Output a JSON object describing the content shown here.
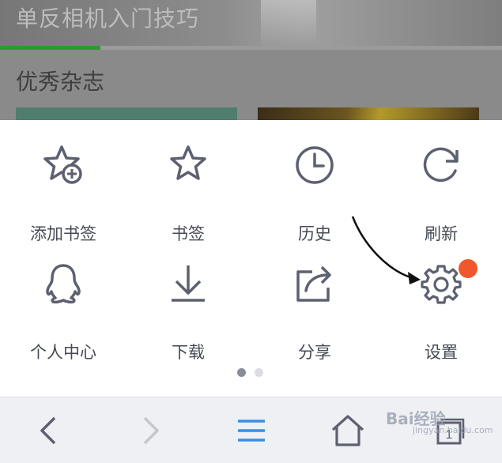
{
  "background_page": {
    "banner_title": "单反相机入门技巧",
    "section_title": "优秀杂志",
    "progress_percent": 20
  },
  "menu": {
    "items": [
      {
        "label": "添加书签",
        "icon": "add-bookmark-star-icon"
      },
      {
        "label": "书签",
        "icon": "bookmark-star-icon"
      },
      {
        "label": "历史",
        "icon": "history-clock-icon"
      },
      {
        "label": "刷新",
        "icon": "refresh-icon"
      },
      {
        "label": "个人中心",
        "icon": "qq-penguin-icon"
      },
      {
        "label": "下载",
        "icon": "download-icon"
      },
      {
        "label": "分享",
        "icon": "share-icon"
      },
      {
        "label": "设置",
        "icon": "settings-gear-icon"
      }
    ],
    "page_indicator": {
      "pages": 2,
      "current": 1
    },
    "settings_badge_color": "#f0572c"
  },
  "toolbar": {
    "buttons": [
      "back-icon",
      "forward-icon",
      "menu-icon",
      "home-icon",
      "tabs-icon"
    ],
    "tabs_count": "1"
  },
  "watermark": {
    "text": "Bai经验",
    "sub": "jingyan.baidu.com"
  },
  "colors": {
    "icon": "#5d6070",
    "accent_blue": "#3a8fe0",
    "disabled": "#c5c7cf",
    "progress": "#2e9a2e"
  }
}
